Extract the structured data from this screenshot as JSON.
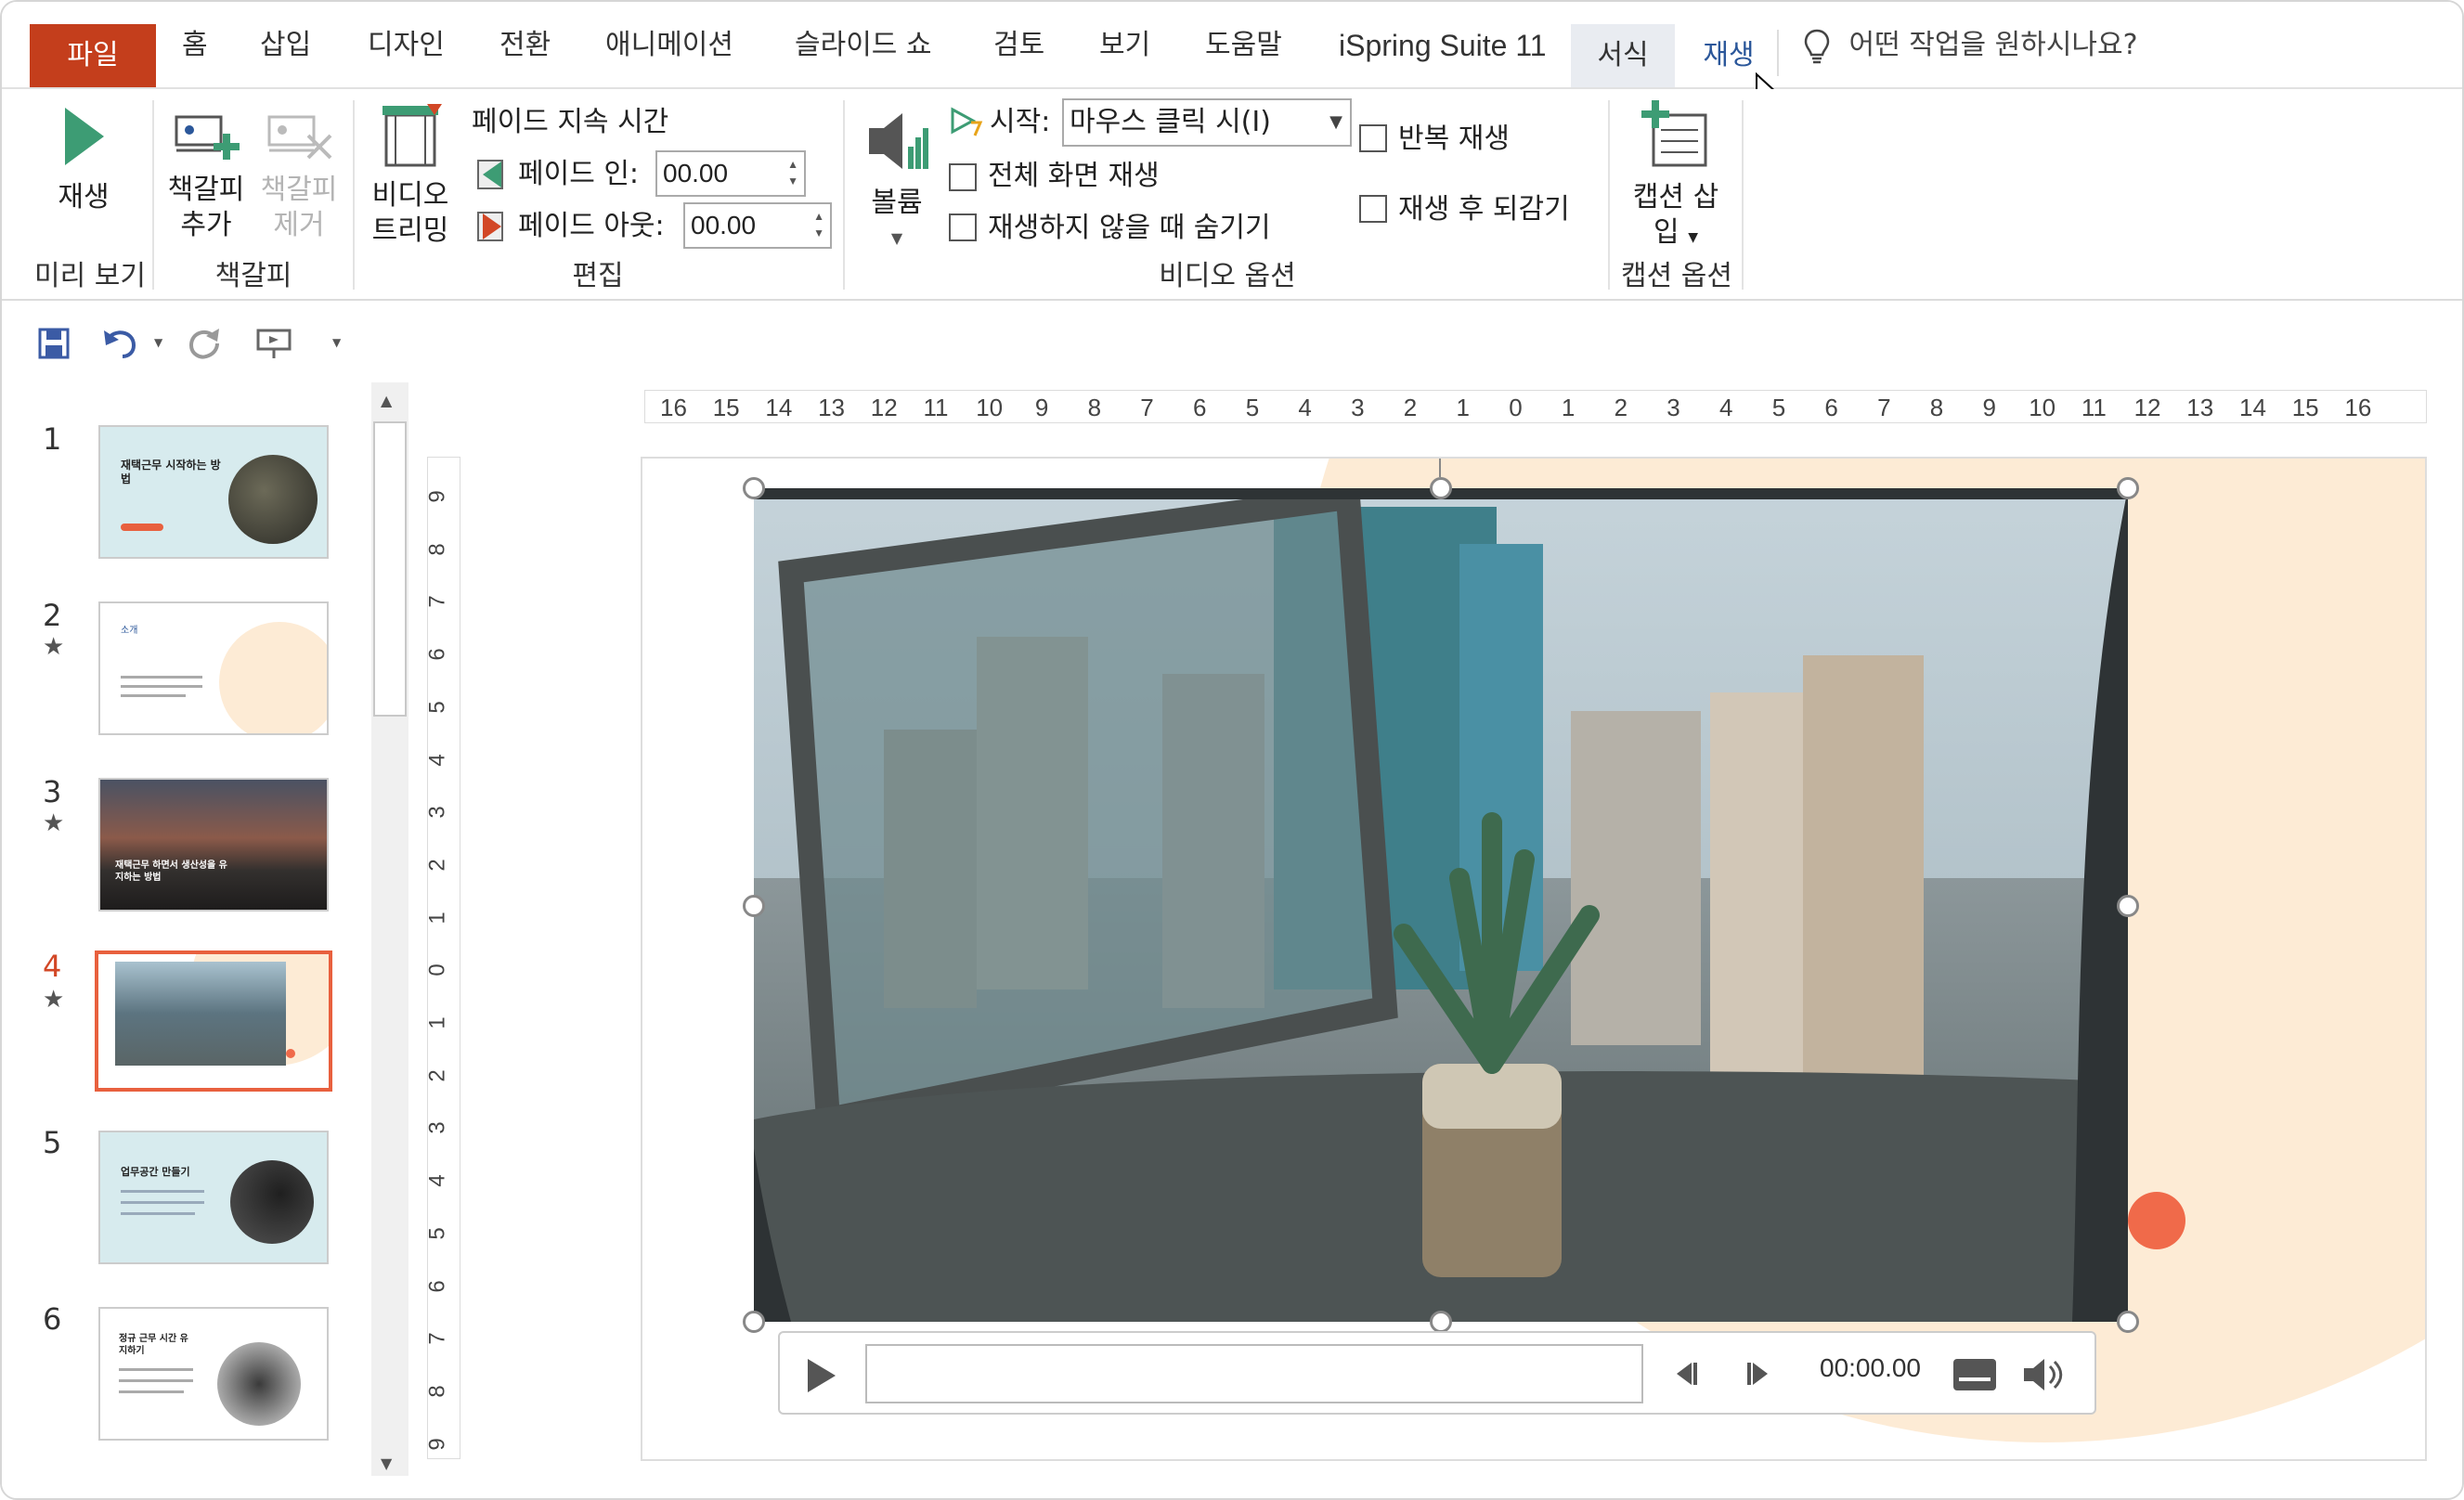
{
  "tabs": {
    "file": "파일",
    "items": [
      "홈",
      "삽입",
      "디자인",
      "전환",
      "애니메이션",
      "슬라이드 쇼",
      "검토",
      "보기",
      "도움말",
      "iSpring Suite 11"
    ],
    "format": "서식",
    "playback": "재생",
    "tell_me": "어떤 작업을 원하시나요?"
  },
  "ribbon": {
    "preview": {
      "play": "재생",
      "group": "미리 보기"
    },
    "bookmarks": {
      "add_line1": "책갈피",
      "add_line2": "추가",
      "remove_line1": "책갈피",
      "remove_line2": "제거",
      "group": "책갈피"
    },
    "editing": {
      "trim_line1": "비디오",
      "trim_line2": "트리밍",
      "fade_duration": "페이드 지속 시간",
      "fade_in_label": "페이드 인:",
      "fade_in_value": "00.00",
      "fade_out_label": "페이드 아웃:",
      "fade_out_value": "00.00",
      "group": "편집"
    },
    "video_options": {
      "volume": "볼륨",
      "start_label": "시작:",
      "start_value": "마우스 클릭 시(I)",
      "fullscreen": "전체 화면 재생",
      "hide": "재생하지 않을 때 숨기기",
      "loop": "반복 재생",
      "rewind": "재생 후 되감기",
      "group": "비디오 옵션"
    },
    "caption": {
      "insert_line1": "캡션 삽",
      "insert_line2": "입",
      "group": "캡션 옵션"
    }
  },
  "thumbnails": [
    {
      "number": "1",
      "title": "재택근무 시작하는 방법",
      "has_star": false,
      "active": false
    },
    {
      "number": "2",
      "title": "소개",
      "has_star": true,
      "active": false
    },
    {
      "number": "3",
      "title": "재택근무 하면서 생산성을 유지하는 방법",
      "has_star": true,
      "active": false
    },
    {
      "number": "4",
      "title": "",
      "has_star": true,
      "active": true
    },
    {
      "number": "5",
      "title": "업무공간 만들기",
      "has_star": false,
      "active": false
    },
    {
      "number": "6",
      "title": "정규 근무 시간 유지하기",
      "has_star": false,
      "active": false
    }
  ],
  "rulers": {
    "horizontal": [
      "16",
      "15",
      "14",
      "13",
      "12",
      "11",
      "10",
      "9",
      "8",
      "7",
      "6",
      "5",
      "4",
      "3",
      "2",
      "1",
      "0",
      "1",
      "2",
      "3",
      "4",
      "5",
      "6",
      "7",
      "8",
      "9",
      "10",
      "11",
      "12",
      "13",
      "14",
      "15",
      "16"
    ],
    "vertical": [
      "9",
      "8",
      "7",
      "6",
      "5",
      "4",
      "3",
      "2",
      "1",
      "0",
      "1",
      "2",
      "3",
      "4",
      "5",
      "6",
      "7",
      "8",
      "9"
    ]
  },
  "player": {
    "time": "00:00.00"
  },
  "colors": {
    "file_tab": "#c43e1c",
    "accent_blue": "#2b579a",
    "active_thumb": "#e8603e",
    "blob": "#fdebd5",
    "dot": "#f06a4a"
  }
}
